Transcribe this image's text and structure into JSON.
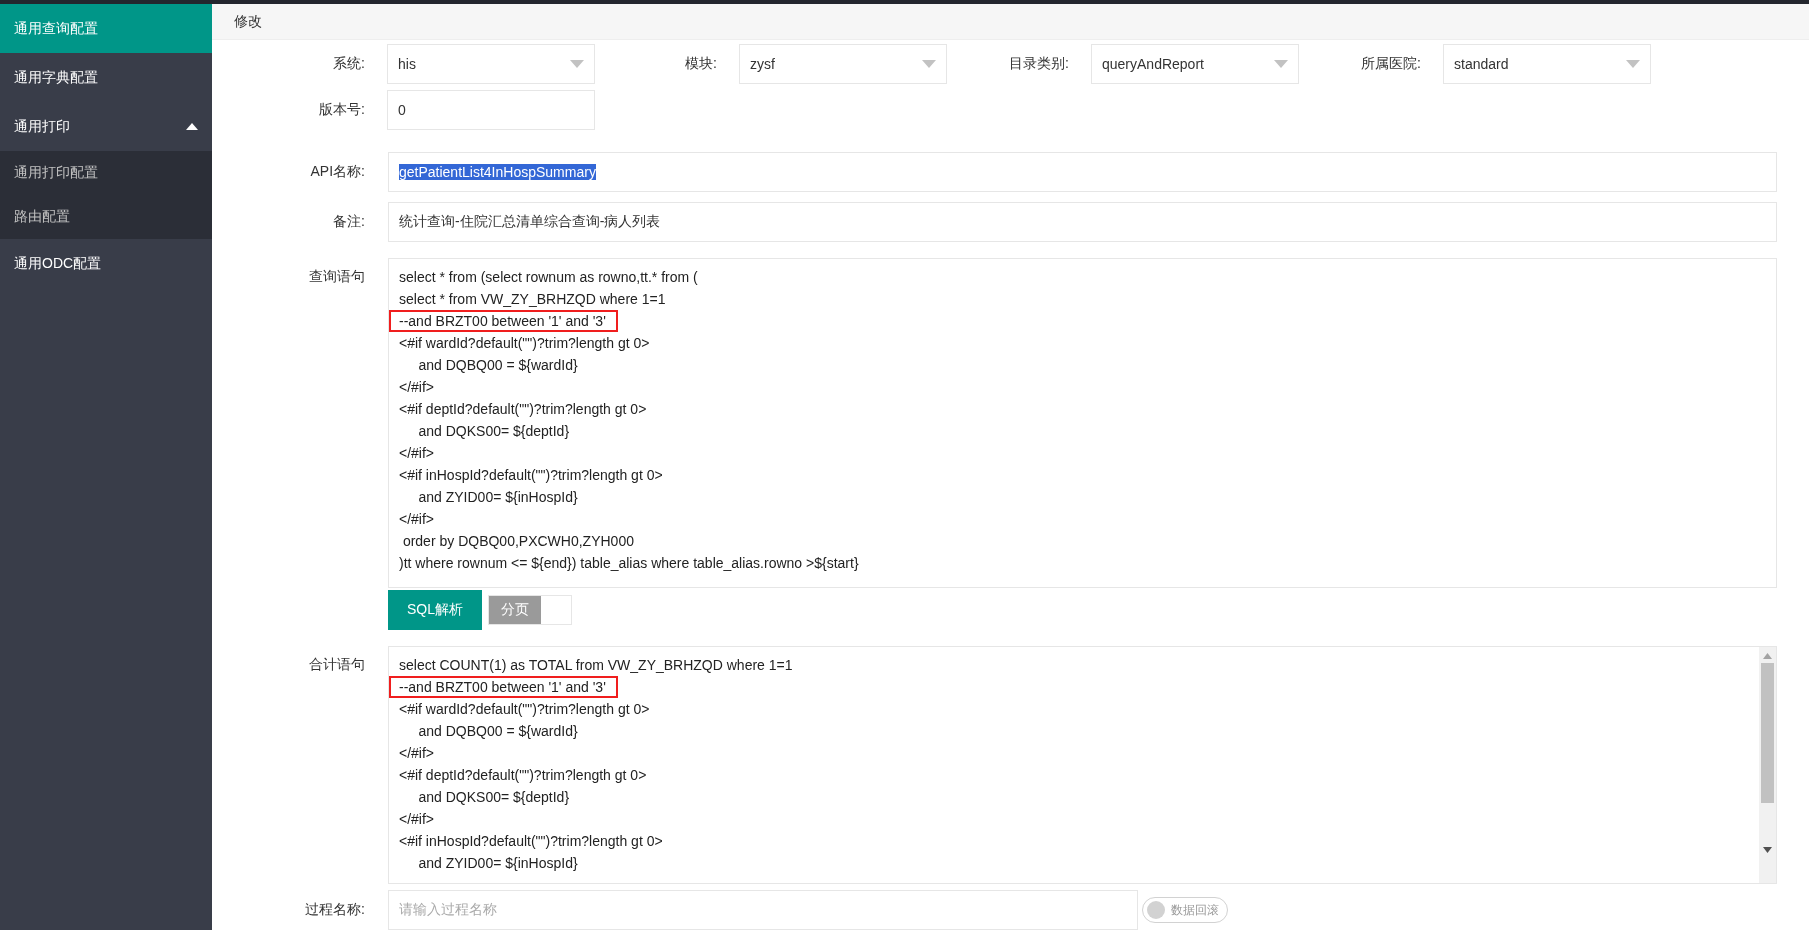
{
  "sidebar": {
    "items": [
      {
        "label": "通用查询配置",
        "selected": true
      },
      {
        "label": "通用字典配置",
        "selected": false
      },
      {
        "label": "通用打印",
        "selected": false,
        "expanded": true,
        "children": [
          {
            "label": "通用打印配置",
            "selected": false
          },
          {
            "label": "路由配置",
            "selected": false
          }
        ]
      },
      {
        "label": "通用ODC配置",
        "selected": false
      }
    ]
  },
  "header": {
    "title": "修改"
  },
  "form": {
    "selectors": [
      {
        "label": "系统:",
        "value": "his",
        "kind": "select"
      },
      {
        "label": "模块:",
        "value": "zysf",
        "kind": "select"
      },
      {
        "label": "目录类别:",
        "value": "queryAndReport",
        "kind": "select"
      },
      {
        "label": "所属医院:",
        "value": "standard",
        "kind": "select"
      }
    ],
    "version": {
      "label": "版本号:",
      "value": "0",
      "kind": "input"
    },
    "api_name": {
      "label": "API名称:",
      "value": "getPatientList4InHospSummary",
      "selected": true
    },
    "remark": {
      "label": "备注:",
      "value": "统计查询-住院汇总清单综合查询-病人列表"
    },
    "query": {
      "label": "查询语句",
      "lines": [
        {
          "text": "select * from (select rownum as rowno,tt.* from (",
          "highlighted": false
        },
        {
          "text": "select * from VW_ZY_BRHZQD where 1=1",
          "highlighted": false
        },
        {
          "text": "--and BRZT00 between '1' and '3'",
          "highlighted": true
        },
        {
          "text": "<#if wardId?default(\"\")?trim?length gt 0>",
          "highlighted": false
        },
        {
          "text": "\tand DQBQ00 = ${wardId}",
          "highlighted": false
        },
        {
          "text": "</#if>",
          "highlighted": false
        },
        {
          "text": "<#if deptId?default(\"\")?trim?length gt 0>",
          "highlighted": false
        },
        {
          "text": "\tand DQKS00= ${deptId}",
          "highlighted": false
        },
        {
          "text": "</#if>",
          "highlighted": false
        },
        {
          "text": "<#if inHospId?default(\"\")?trim?length gt 0>",
          "highlighted": false
        },
        {
          "text": "\tand ZYID00= ${inHospId}",
          "highlighted": false
        },
        {
          "text": "</#if>",
          "highlighted": false
        },
        {
          "text": " order by DQBQ00,PXCWH0,ZYH000",
          "highlighted": false
        },
        {
          "text": ")tt where rownum <= ${end}) table_alias where table_alias.rowno >${start}",
          "highlighted": false
        }
      ]
    },
    "sql_button": {
      "label": "SQL解析"
    },
    "paging_toggle": {
      "label": "分页",
      "on": false
    },
    "total": {
      "label": "合计语句",
      "lines": [
        {
          "text": "select COUNT(1) as TOTAL from VW_ZY_BRHZQD where 1=1",
          "highlighted": false
        },
        {
          "text": "--and BRZT00 between '1' and '3'",
          "highlighted": true
        },
        {
          "text": "<#if wardId?default(\"\")?trim?length gt 0>",
          "highlighted": false
        },
        {
          "text": "\tand DQBQ00 = ${wardId}",
          "highlighted": false
        },
        {
          "text": "</#if>",
          "highlighted": false
        },
        {
          "text": "<#if deptId?default(\"\")?trim?length gt 0>",
          "highlighted": false
        },
        {
          "text": "\tand DQKS00= ${deptId}",
          "highlighted": false
        },
        {
          "text": "</#if>",
          "highlighted": false
        },
        {
          "text": "<#if inHospId?default(\"\")?trim?length gt 0>",
          "highlighted": false
        },
        {
          "text": "\tand ZYID00= ${inHospId}",
          "highlighted": false
        }
      ]
    },
    "procedure": {
      "label": "过程名称:",
      "placeholder": "请输入过程名称",
      "rollback_toggle": {
        "label": "数据回滚",
        "on": false
      }
    }
  }
}
